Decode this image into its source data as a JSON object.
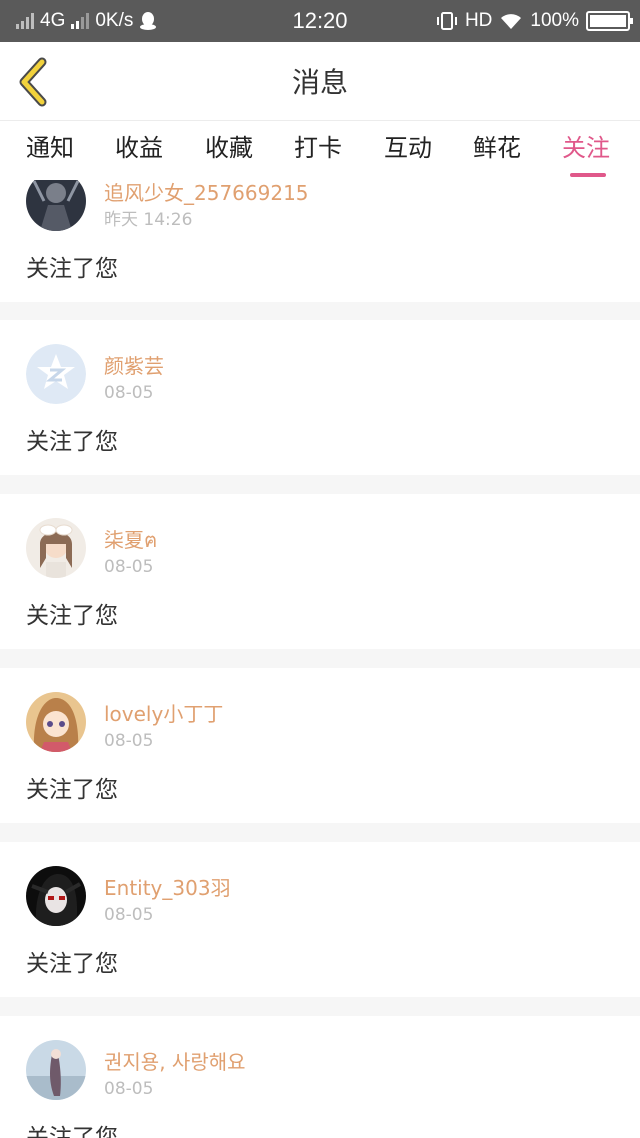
{
  "status_bar": {
    "network": "4G",
    "speed": "0K/s",
    "time": "12:20",
    "hd": "HD",
    "battery": "100%"
  },
  "header": {
    "title": "消息"
  },
  "tabs": [
    {
      "label": "通知"
    },
    {
      "label": "收益"
    },
    {
      "label": "收藏"
    },
    {
      "label": "打卡"
    },
    {
      "label": "互动"
    },
    {
      "label": "鲜花"
    },
    {
      "label": "关注"
    }
  ],
  "active_tab": "关注",
  "colors": {
    "accent": "#e0588a",
    "username": "#e0a070",
    "status_bar": "#5a5a5a"
  },
  "notifications": [
    {
      "name": "追风少女_257669215",
      "date": "昨天 14:26",
      "message": "关注了您"
    },
    {
      "name": "颜紫芸",
      "date": "08-05",
      "message": "关注了您"
    },
    {
      "name": "柒夏ฅ",
      "date": "08-05",
      "message": "关注了您"
    },
    {
      "name": "lovely小丁丁",
      "date": "08-05",
      "message": "关注了您"
    },
    {
      "name": "Entity_303羽",
      "date": "08-05",
      "message": "关注了您"
    },
    {
      "name": "권지용, 사랑해요",
      "date": "08-05",
      "message": "关注了您"
    }
  ]
}
